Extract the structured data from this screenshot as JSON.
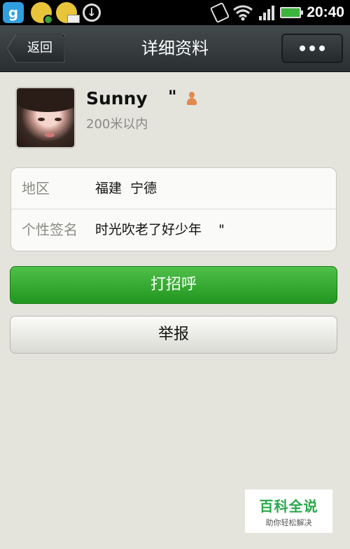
{
  "status_bar": {
    "app_icon_letter": "g",
    "time": "20:40",
    "icons": [
      "app-icon",
      "game-icon",
      "message-icon",
      "download-icon",
      "vibrate-icon",
      "wifi-icon",
      "signal-icon",
      "battery-icon"
    ]
  },
  "header": {
    "back_label": "返回",
    "title": "详细资料"
  },
  "profile": {
    "name": "Sunny",
    "name_suffix": "\"",
    "distance": "200米以内",
    "gender_icon": "female-user-icon"
  },
  "info": {
    "rows": [
      {
        "label": "地区",
        "value": "福建  宁德"
      },
      {
        "label": "个性签名",
        "value": "时光吹老了好少年    \""
      }
    ]
  },
  "actions": {
    "greet_label": "打招呼",
    "report_label": "举报"
  },
  "watermark": {
    "main": "百科全说",
    "sub": "助你轻松解决"
  },
  "colors": {
    "primary_green": "#21961e",
    "title_bar": "#2a3032",
    "background": "#e4e4dc"
  }
}
